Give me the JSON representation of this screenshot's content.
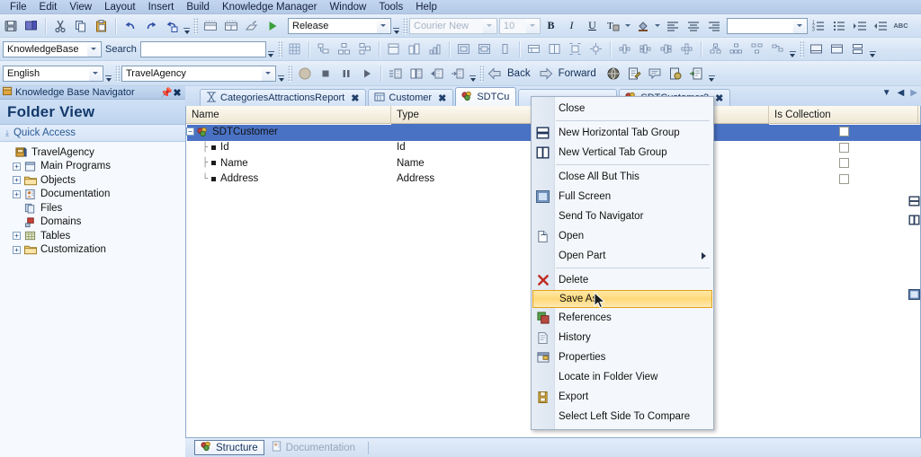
{
  "menubar": {
    "items": [
      {
        "label": "File"
      },
      {
        "label": "Edit"
      },
      {
        "label": "View"
      },
      {
        "label": "Layout"
      },
      {
        "label": "Insert"
      },
      {
        "label": "Build"
      },
      {
        "label": "Knowledge Manager"
      },
      {
        "label": "Window"
      },
      {
        "label": "Tools"
      },
      {
        "label": "Help"
      }
    ]
  },
  "toolbar1": {
    "icons_left": [
      "save-icon",
      "save-all-icon",
      "cut-icon",
      "copy-icon",
      "paste-icon",
      "undo-icon",
      "redo-icon",
      "redo-history-icon"
    ],
    "icons_build": [
      "build-all-icon",
      "rebuild-all-icon",
      "create-icon",
      "run-icon"
    ],
    "environment": {
      "value": "Release",
      "name": "environment-combo"
    },
    "font_family": {
      "value": "Courier New",
      "disabled": true
    },
    "font_size": {
      "value": "10",
      "disabled": true
    },
    "format_buttons": [
      "bold-icon",
      "italic-icon",
      "underline-icon",
      "text-style-icon",
      "fill-color-icon",
      "align-left-icon",
      "align-center-icon",
      "align-right-icon"
    ],
    "style_combo": {
      "value": ""
    },
    "list_buttons": [
      "numbered-list-icon",
      "bulleted-list-icon",
      "increase-indent-icon",
      "decrease-indent-icon",
      "spell-check-icon"
    ]
  },
  "toolbar2": {
    "scope": {
      "value": "KnowledgeBase"
    },
    "search_label": "Search",
    "search_value": "",
    "search_placeholder": "",
    "icons": [
      "grid-icon",
      "diagram-1-icon",
      "diagram-2-icon",
      "diagram-3-icon",
      "chart-1-icon",
      "chart-2-icon",
      "chart-3-icon",
      "layout-1-icon",
      "layout-2-icon",
      "layout-3-icon",
      "layout-4-icon",
      "layout-5-icon",
      "layout-6-icon",
      "layout-7-icon",
      "node-1-icon",
      "node-2-icon",
      "node-3-icon",
      "node-4-icon",
      "tree-1-icon",
      "tree-2-icon",
      "tree-3-icon",
      "tree-4-icon",
      "window-1-icon",
      "window-2-icon",
      "window-3-icon"
    ]
  },
  "toolbar3": {
    "language": {
      "value": "English"
    },
    "kb_version": {
      "value": "TravelAgency"
    },
    "debug_icons": [
      "record-icon",
      "stop-icon",
      "pause-icon",
      "continue-icon",
      "step-into-icon",
      "step-over-icon",
      "step-out-icon",
      "run-to-cursor-icon"
    ],
    "back_label": "Back",
    "forward_label": "Forward",
    "nav_icons": [
      "back-arrow-icon",
      "forward-arrow-icon"
    ],
    "extra_icons": [
      "globe-icon",
      "edit-doc-icon",
      "comment-icon",
      "lock-doc-icon",
      "import-icon"
    ]
  },
  "navigator": {
    "title": "Knowledge Base Navigator",
    "pin_icon": "pin-icon",
    "close_icon": "close-icon",
    "header": "Folder View",
    "quick_access": "Quick Access",
    "tree": [
      {
        "label": "TravelAgency",
        "icon": "knowledge-base-icon",
        "level": 0,
        "expander": "none"
      },
      {
        "label": "Main Programs",
        "icon": "main-programs-icon",
        "level": 1,
        "expander": "+"
      },
      {
        "label": "Objects",
        "icon": "folder-icon",
        "level": 1,
        "expander": "+"
      },
      {
        "label": "Documentation",
        "icon": "documentation-icon",
        "level": 1,
        "expander": "+"
      },
      {
        "label": "Files",
        "icon": "files-icon",
        "level": 1,
        "expander": "none"
      },
      {
        "label": "Domains",
        "icon": "domains-icon",
        "level": 1,
        "expander": "none"
      },
      {
        "label": "Tables",
        "icon": "tables-icon",
        "level": 1,
        "expander": "+"
      },
      {
        "label": "Customization",
        "icon": "folder-icon",
        "level": 1,
        "expander": "+"
      }
    ]
  },
  "main": {
    "tabs": [
      {
        "label": "CategoriesAttractionsReport",
        "icon": "report-icon",
        "active": false,
        "close": "✖"
      },
      {
        "label": "Customer",
        "icon": "transaction-icon",
        "active": false,
        "close": "✖"
      },
      {
        "label": "SDTCu",
        "icon": "sdt-icon",
        "active": true,
        "close": ""
      },
      {
        "label": "",
        "icon": "",
        "active": false,
        "close": ""
      },
      {
        "label": "SDTCustomer2",
        "icon": "sdt-icon",
        "active": false,
        "close": "✖"
      }
    ],
    "tab_nav": [
      "tab-list-icon",
      "tab-prev-icon",
      "tab-next-icon"
    ],
    "grid": {
      "columns": [
        "Name",
        "Type",
        "Is Collection"
      ],
      "rows": [
        {
          "name": "SDTCustomer",
          "type": "",
          "is_collection": false,
          "level": 0,
          "selected": true,
          "expander": "-",
          "icon": "sdt-icon"
        },
        {
          "name": "Id",
          "type": "Id",
          "is_collection": false,
          "level": 1,
          "selected": false,
          "expander": "none",
          "icon": "attribute-icon"
        },
        {
          "name": "Name",
          "type": "Name",
          "is_collection": false,
          "level": 1,
          "selected": false,
          "expander": "none",
          "icon": "attribute-icon"
        },
        {
          "name": "Address",
          "type": "Address",
          "is_collection": false,
          "level": 1,
          "selected": false,
          "expander": "none",
          "icon": "attribute-icon"
        }
      ]
    },
    "bottom_tabs": [
      {
        "label": "Structure",
        "icon": "structure-icon",
        "active": true
      },
      {
        "label": "Documentation",
        "icon": "documentation-icon",
        "active": false
      }
    ]
  },
  "context_menu": {
    "items": [
      {
        "label": "Close",
        "icon": "",
        "accel": "C",
        "sep_after": true
      },
      {
        "label": "New Horizontal Tab Group",
        "icon": "horizontal-tab-group-icon",
        "accel": "z"
      },
      {
        "label": "New Vertical Tab Group",
        "icon": "vertical-tab-group-icon",
        "accel": "V",
        "sep_after": true
      },
      {
        "label": "Close All But This",
        "icon": "",
        "accel": "C"
      },
      {
        "label": "Full Screen",
        "icon": "full-screen-icon",
        "accel": "F"
      },
      {
        "label": "Send To Navigator",
        "icon": "",
        "accel": "S"
      },
      {
        "label": "Open",
        "icon": "open-icon",
        "accel": "O"
      },
      {
        "label": "Open Part",
        "icon": "",
        "accel": "P",
        "submenu": true
      },
      {
        "label": "Delete",
        "icon": "delete-icon",
        "accel": "D"
      },
      {
        "label": "Save As..",
        "icon": "",
        "accel": "A",
        "highlighted": true
      },
      {
        "label": "References",
        "icon": "references-icon",
        "accel": "R"
      },
      {
        "label": "History",
        "icon": "history-icon",
        "accel": "H"
      },
      {
        "label": "Properties",
        "icon": "properties-icon",
        "accel": "P"
      },
      {
        "label": "Locate in Folder View",
        "icon": "",
        "accel": ""
      },
      {
        "label": "Export",
        "icon": "export-icon",
        "accel": "E"
      },
      {
        "label": "Select Left Side To Compare",
        "icon": "",
        "accel": "L"
      }
    ]
  },
  "colors": {
    "highlight_orange": "#ffd979",
    "selection_blue": "#4a72c4",
    "chrome_blue": "#cfe0f4",
    "accent_text": "#12305a"
  }
}
